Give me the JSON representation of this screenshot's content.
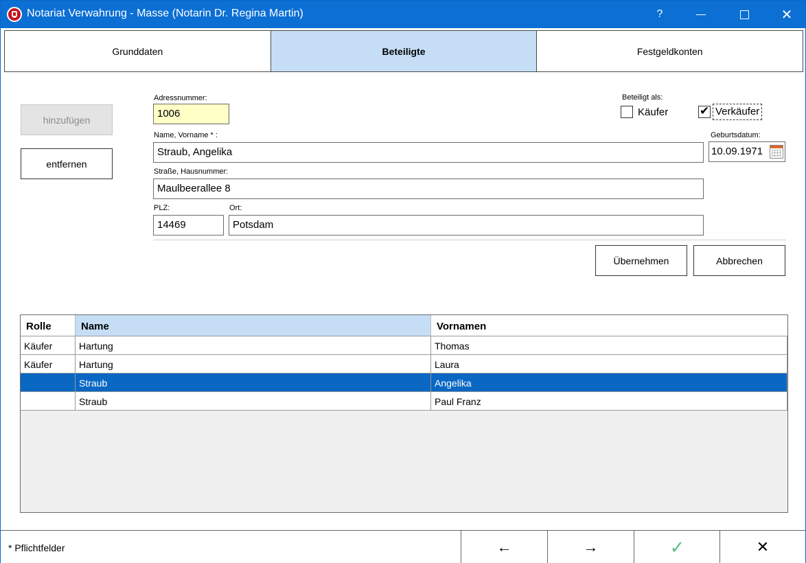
{
  "window": {
    "title": "Notariat Verwahrung - Masse (Notarin Dr. Regina Martin)",
    "help": "?"
  },
  "tabs": [
    {
      "label": "Grunddaten"
    },
    {
      "label": "Beteiligte"
    },
    {
      "label": "Festgeldkonten"
    }
  ],
  "buttons": {
    "add": "hinzufügen",
    "remove": "entfernen",
    "apply": "Übernehmen",
    "cancel": "Abbrechen"
  },
  "form": {
    "adressnummer_label": "Adressnummer:",
    "adressnummer": "1006",
    "name_label": "Name, Vorname * :",
    "name": "Straub, Angelika",
    "strasse_label": "Straße, Hausnummer:",
    "strasse": "Maulbeerallee 8",
    "plz_label": "PLZ:",
    "plz": "14469",
    "ort_label": "Ort:",
    "ort": "Potsdam",
    "beteiligt_label": "Beteiligt als:",
    "kaeufer_label": "Käufer",
    "kaeufer_checked": false,
    "verkaeufer_label": "Verkäufer",
    "verkaeufer_checked": true,
    "geburtsdatum_label": "Geburtsdatum:",
    "geburtsdatum": "10.09.1971"
  },
  "grid": {
    "columns": [
      "Rolle",
      "Name",
      "Vornamen"
    ],
    "rows": [
      {
        "rolle": "Käufer",
        "name": "Hartung",
        "vornamen": "Thomas"
      },
      {
        "rolle": "Käufer",
        "name": "Hartung",
        "vornamen": "Laura"
      },
      {
        "rolle": "",
        "name": "Straub",
        "vornamen": "Angelika"
      },
      {
        "rolle": "",
        "name": "Straub",
        "vornamen": "Paul Franz"
      }
    ]
  },
  "status": {
    "text": "* Pflichtfelder",
    "back": "←",
    "forward": "→",
    "ok": "✓",
    "close": "✕"
  },
  "colors": {
    "titlebar": "#0b6fd4",
    "accent": "#c5def5",
    "selection": "#0a67c4",
    "required_field": "#ffffc6",
    "ok": "#5fbf86"
  }
}
